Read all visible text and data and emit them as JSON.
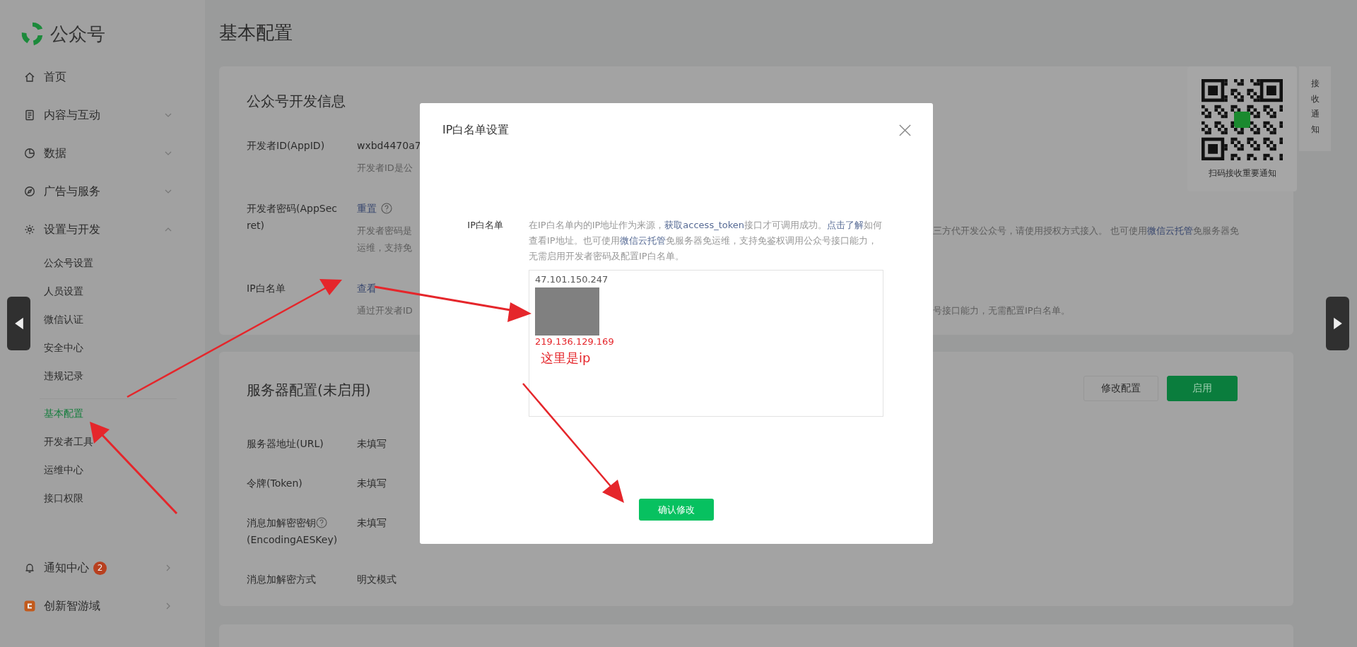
{
  "logo": {
    "text": "公众号"
  },
  "sidebar": {
    "items": [
      {
        "label": "首页"
      },
      {
        "label": "内容与互动",
        "expanded": false
      },
      {
        "label": "数据",
        "expanded": false
      },
      {
        "label": "广告与服务",
        "expanded": false
      },
      {
        "label": "设置与开发",
        "expanded": true,
        "children": [
          {
            "label": "公众号设置",
            "selected": false
          },
          {
            "label": "人员设置",
            "selected": false
          },
          {
            "label": "微信认证",
            "selected": false
          },
          {
            "label": "安全中心",
            "selected": false
          },
          {
            "label": "违规记录",
            "selected": false
          },
          {
            "label": "基本配置",
            "selected": true
          },
          {
            "label": "开发者工具",
            "selected": false
          },
          {
            "label": "运维中心",
            "selected": false
          },
          {
            "label": "接口权限",
            "selected": false
          }
        ]
      }
    ],
    "footer_items": [
      {
        "label": "通知中心",
        "badge": "2"
      },
      {
        "label": "创新智游域"
      }
    ]
  },
  "page_title": "基本配置",
  "dev_card": {
    "title": "公众号开发信息",
    "rows": [
      {
        "label": "开发者ID(AppID)",
        "value": "wxbd4470a7",
        "notes": [
          "开发者ID是公"
        ]
      },
      {
        "label": "开发者密码(AppSecret)",
        "link": "重置",
        "help": true,
        "notes": [
          "开发者密码是",
          "运维，支持免"
        ],
        "right_note": [
          {
            "text": "三方代开发公众号，请使用授权方式接入。 也可使用"
          },
          {
            "text": "微信云托管",
            "link": true
          },
          {
            "text": "免服务器免"
          }
        ]
      },
      {
        "label": "IP白名单",
        "link": "查看",
        "notes": [
          "通过开发者ID"
        ],
        "right_note": [
          {
            "text": "号接口能力，无需配置IP白名单。"
          }
        ]
      }
    ]
  },
  "server_card": {
    "title": "服务器配置(未启用)",
    "buttons": [
      {
        "label": "修改配置",
        "kind": "default"
      },
      {
        "label": "启用",
        "kind": "primary"
      }
    ],
    "rows": [
      {
        "label": "服务器地址(URL)",
        "value": "未填写"
      },
      {
        "label": "令牌(Token)",
        "value": "未填写"
      },
      {
        "label": "消息加解密密钥",
        "help": true,
        "label2": "(EncodingAESKey)",
        "value": "未填写"
      },
      {
        "label": "消息加解密方式",
        "value": "明文模式"
      }
    ]
  },
  "qr_panel": {
    "caption": "扫码接收重要通知"
  },
  "notify_tab": {
    "label": "接收通知"
  },
  "modal": {
    "title": "IP白名单设置",
    "form_label": "IP白名单",
    "description": [
      {
        "text": "在IP白名单内的IP地址作为来源，"
      },
      {
        "text": "获取access_token",
        "link": true
      },
      {
        "text": "接口才可调用成功。"
      },
      {
        "text": "点击了解",
        "link": true
      },
      {
        "text": "如何查看IP地址。也可使用"
      },
      {
        "text": "微信云托管",
        "link": true
      },
      {
        "text": "免服务器免运维，支持免鉴权调用公众号接口能力，无需启用开发者密码及配置IP白名单。"
      }
    ],
    "ip_list": [
      "47.101.150.247",
      "219.136.129.169"
    ],
    "confirm": "确认修改"
  },
  "annotation": {
    "text": "这里是ip"
  }
}
